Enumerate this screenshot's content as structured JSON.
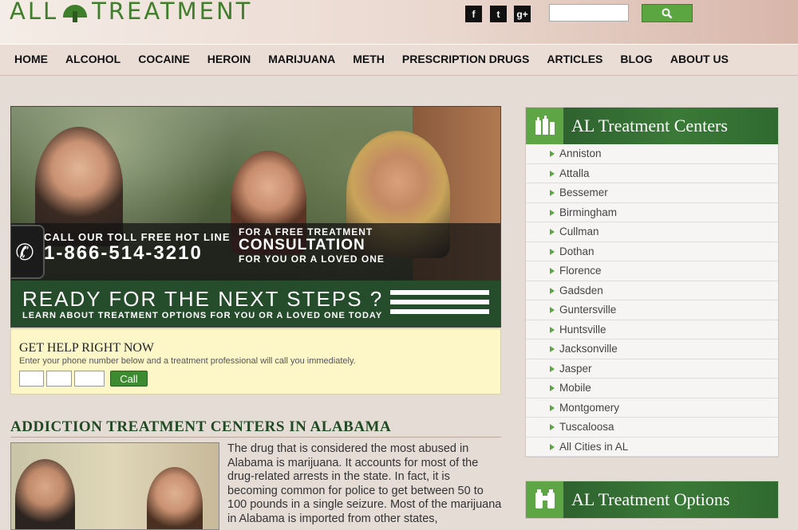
{
  "header": {
    "logo": {
      "left": "ALL",
      "right": "TREATMENT"
    },
    "social": [
      {
        "name": "facebook-icon",
        "glyph": "f"
      },
      {
        "name": "twitter-icon",
        "glyph": "t"
      },
      {
        "name": "google-plus-icon",
        "glyph": "g+"
      }
    ],
    "search": {
      "placeholder": "",
      "button_icon": "search-icon"
    }
  },
  "nav": {
    "items": [
      "HOME",
      "ALCOHOL",
      "COCAINE",
      "HEROIN",
      "MARIJUANA",
      "METH",
      "PRESCRIPTION DRUGS",
      "ARTICLES",
      "BLOG",
      "ABOUT US"
    ]
  },
  "hero": {
    "call_label": "CALL OUR TOLL FREE HOT LINE",
    "phone_number": "1-866-514-3210",
    "consult_line1": "FOR A FREE TREATMENT",
    "consult_line2": "CONSULTATION",
    "consult_line3": "FOR YOU OR A LOVED ONE",
    "ready_title": "READY FOR THE NEXT STEPS ?",
    "ready_sub": "LEARN ABOUT TREATMENT OPTIONS FOR YOU OR A LOVED ONE TODAY"
  },
  "get_help": {
    "title": "GET HELP RIGHT NOW",
    "text": "Enter your phone number below and a treatment professional will call you immediately.",
    "call_label": "Call"
  },
  "article": {
    "title": "ADDICTION TREATMENT CENTERS IN ALABAMA",
    "body": "The drug that is considered the most abused in Alabama is marijuana. It accounts for most of the drug-related arrests in the state. In fact, it is becoming common for police to get between 50 to 100 pounds in a single seizure. Most of the marijuana in Alabama is imported from other states,"
  },
  "sidebar": {
    "centers": {
      "title": "AL Treatment Centers",
      "items": [
        "Anniston",
        "Attalla",
        "Bessemer",
        "Birmingham",
        "Cullman",
        "Dothan",
        "Florence",
        "Gadsden",
        "Guntersville",
        "Huntsville",
        "Jacksonville",
        "Jasper",
        "Mobile",
        "Montgomery",
        "Tuscaloosa",
        "All Cities in AL"
      ]
    },
    "options": {
      "title": "AL Treatment Options"
    }
  },
  "colors": {
    "accent_green": "#3f7f2b",
    "dark_green": "#264d2b",
    "help_bg": "#fdf7c8"
  }
}
